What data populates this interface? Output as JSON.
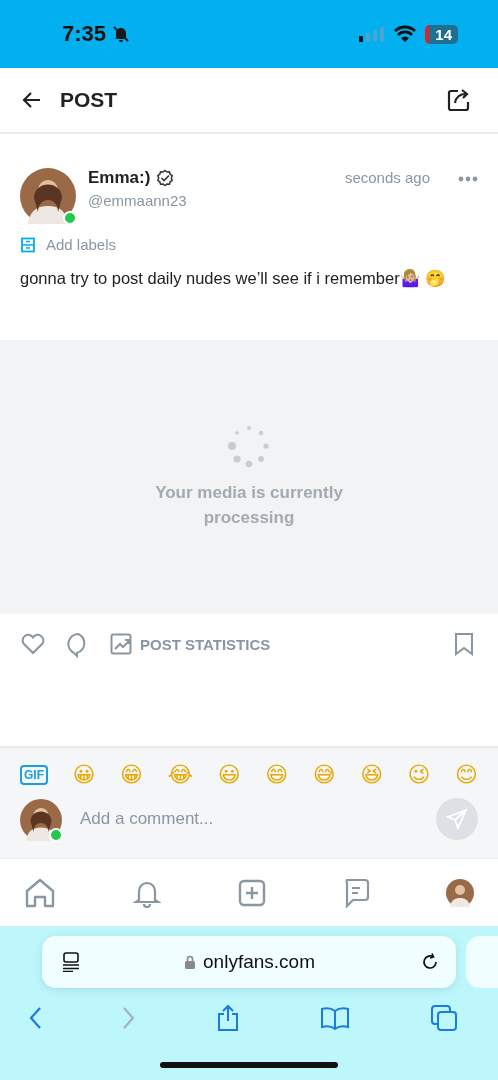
{
  "status_bar": {
    "time": "7:35",
    "battery": "14"
  },
  "header": {
    "title": "POST"
  },
  "post": {
    "author": "Emma:)",
    "handle": "@emmaann23",
    "time": "seconds ago",
    "online": true,
    "add_labels": "Add labels",
    "text": "gonna try to post daily nudes we’ll see if i remember🤷🏼‍♀️ 🤭",
    "media_status": "Your media is currently processing"
  },
  "actions": {
    "statistics": "POST STATISTICS"
  },
  "emoji_bar": {
    "gif": "GIF",
    "emojis": [
      "😀",
      "😁",
      "😂",
      "😃",
      "😄",
      "😅",
      "😆",
      "😉",
      "😊"
    ]
  },
  "comment": {
    "placeholder": "Add a comment...",
    "online": true
  },
  "browser": {
    "url": "onlyfans.com"
  }
}
